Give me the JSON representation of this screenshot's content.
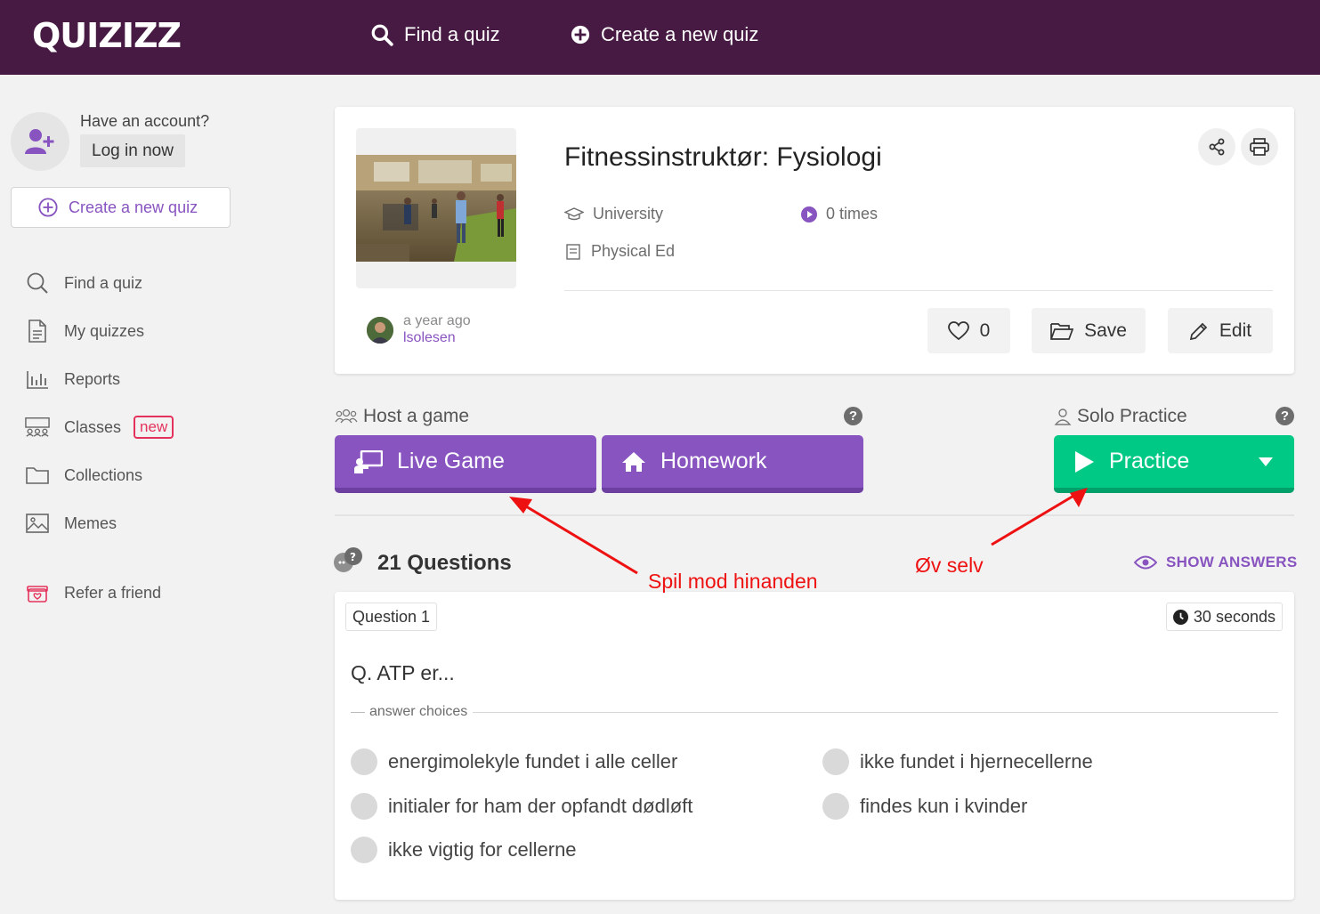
{
  "topbar": {
    "logo": "QUIZIZZ",
    "find_label": "Find a quiz",
    "create_label": "Create a new quiz"
  },
  "sidebar": {
    "have_account": "Have an account?",
    "login": "Log in now",
    "create_quiz": "Create a new quiz",
    "items": [
      {
        "label": "Find a quiz",
        "icon": "search-icon"
      },
      {
        "label": "My quizzes",
        "icon": "document-icon"
      },
      {
        "label": "Reports",
        "icon": "bar-chart-icon"
      },
      {
        "label": "Classes",
        "icon": "classroom-icon",
        "badge": "new"
      },
      {
        "label": "Collections",
        "icon": "folder-icon"
      },
      {
        "label": "Memes",
        "icon": "image-icon"
      },
      {
        "label": "Refer a friend",
        "icon": "gift-icon"
      }
    ]
  },
  "quiz": {
    "title": "Fitnessinstruktør: Fysiologi",
    "grade": "University",
    "plays": "0 times",
    "subject": "Physical Ed",
    "updated": "a year ago",
    "author": "lsolesen",
    "likes": "0",
    "save_label": "Save",
    "edit_label": "Edit"
  },
  "host": {
    "label": "Host a game",
    "live_game": "Live Game",
    "homework": "Homework"
  },
  "solo": {
    "label": "Solo Practice",
    "practice": "Practice"
  },
  "help_glyph": "?",
  "questions": {
    "count_label": "21 Questions",
    "show_answers": "SHOW ANSWERS",
    "q1": {
      "number": "Question 1",
      "time": "30 seconds",
      "text": "Q. ATP er...",
      "choices_label": "answer choices",
      "choices": [
        "energimolekyle fundet i alle celler",
        "ikke fundet i hjernecellerne",
        "initialer for ham der opfandt dødløft",
        "findes kun i kvinder",
        "ikke vigtig for cellerne"
      ]
    }
  },
  "annotations": {
    "left": "Spil mod hinanden",
    "right": "Øv selv"
  },
  "colors": {
    "topbar": "#461a42",
    "accent_purple": "#8854c0",
    "accent_green": "#00c985",
    "annotation_red": "#ee1111"
  }
}
